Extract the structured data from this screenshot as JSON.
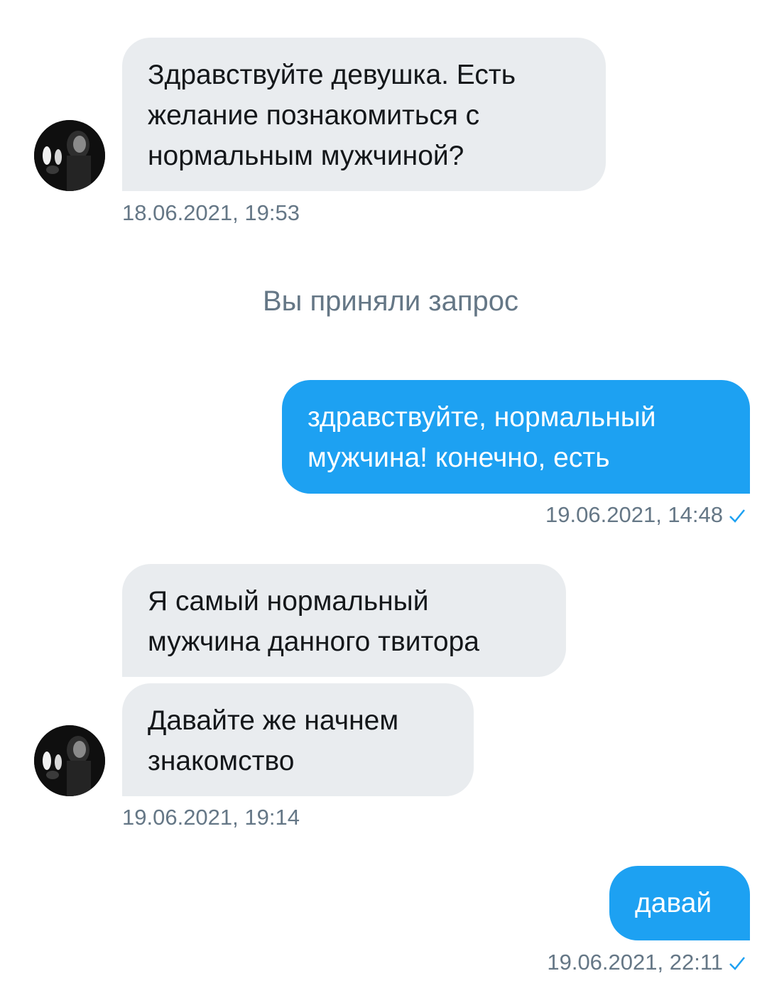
{
  "conversation": {
    "messages": [
      {
        "direction": "incoming",
        "text": "Здравствуйте девушка. Есть\nжелание познакомиться с\nнормальным мужчиной?",
        "timestamp": "18.06.2021, 19:53"
      },
      {
        "direction": "incoming",
        "text": "Я самый нормальный\nмужчина данного твитора"
      },
      {
        "direction": "incoming",
        "text": "Давайте же начнем\nзнакомство",
        "timestamp": "19.06.2021, 19:14"
      }
    ],
    "system_notice": "Вы приняли запрос",
    "sent": [
      {
        "direction": "outgoing",
        "text": "здравствуйте, нормальный\nмужчина! конечно, есть",
        "timestamp": "19.06.2021, 14:48",
        "status_icon": "checkmark-icon"
      },
      {
        "direction": "outgoing",
        "text": "давай",
        "timestamp": "19.06.2021, 22:11",
        "status_icon": "checkmark-icon"
      }
    ],
    "avatar_icon": "user-avatar-icon"
  },
  "colors": {
    "incoming_bubble": "#e9ecef",
    "outgoing_bubble": "#1da1f2",
    "timestamp_text": "#657786",
    "message_text": "#14171a"
  }
}
